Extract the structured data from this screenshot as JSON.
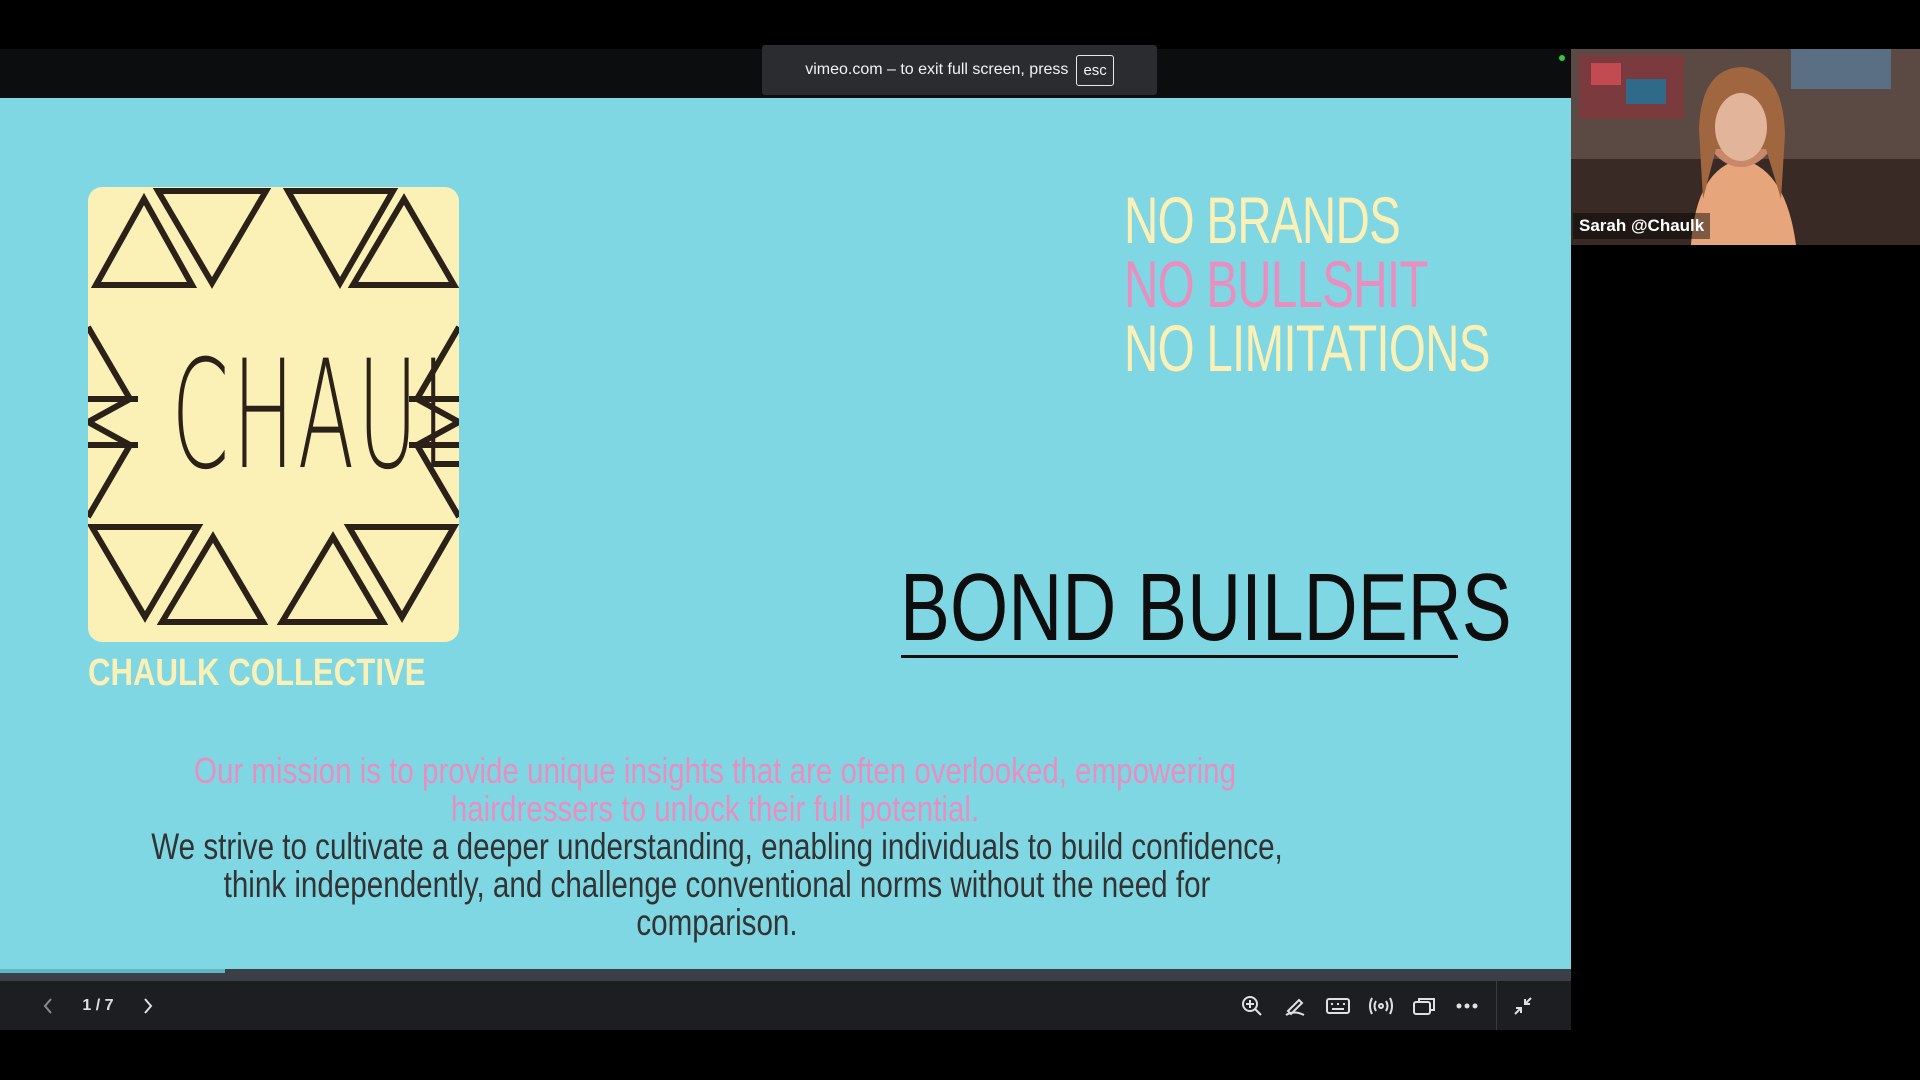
{
  "banner": {
    "text": "vimeo.com – to exit full screen, press",
    "key": "esc"
  },
  "slide": {
    "logo_text": "CHAULK",
    "brand_name": "CHAULK COLLECTIVE",
    "tagline": [
      "NO BRANDS",
      "NO BULLSHIT",
      "NO LIMITATIONS"
    ],
    "heading": "BOND BUILDERS",
    "mission": "Our mission is to provide unique insights that are often overlooked, empowering hairdressers to unlock their full potential.",
    "strive": "We strive to cultivate a deeper understanding, enabling individuals to build confidence, think independently, and challenge conventional norms without the need for comparison."
  },
  "controls": {
    "counter": "1 / 7",
    "progress": 0.143,
    "icons": [
      "chevron-left-icon",
      "chevron-right-icon",
      "zoom-in-icon",
      "pen-icon",
      "keyboard-icon",
      "broadcast-icon",
      "window-icon",
      "more-icon",
      "minimize-icon"
    ]
  },
  "camera": {
    "label": "Sarah @Chaulk"
  },
  "colors": {
    "slide_bg": "#7fd7e3",
    "cream": "#fbf0b5",
    "pink": "#e98fc0",
    "dark": "#0e0e0e"
  }
}
